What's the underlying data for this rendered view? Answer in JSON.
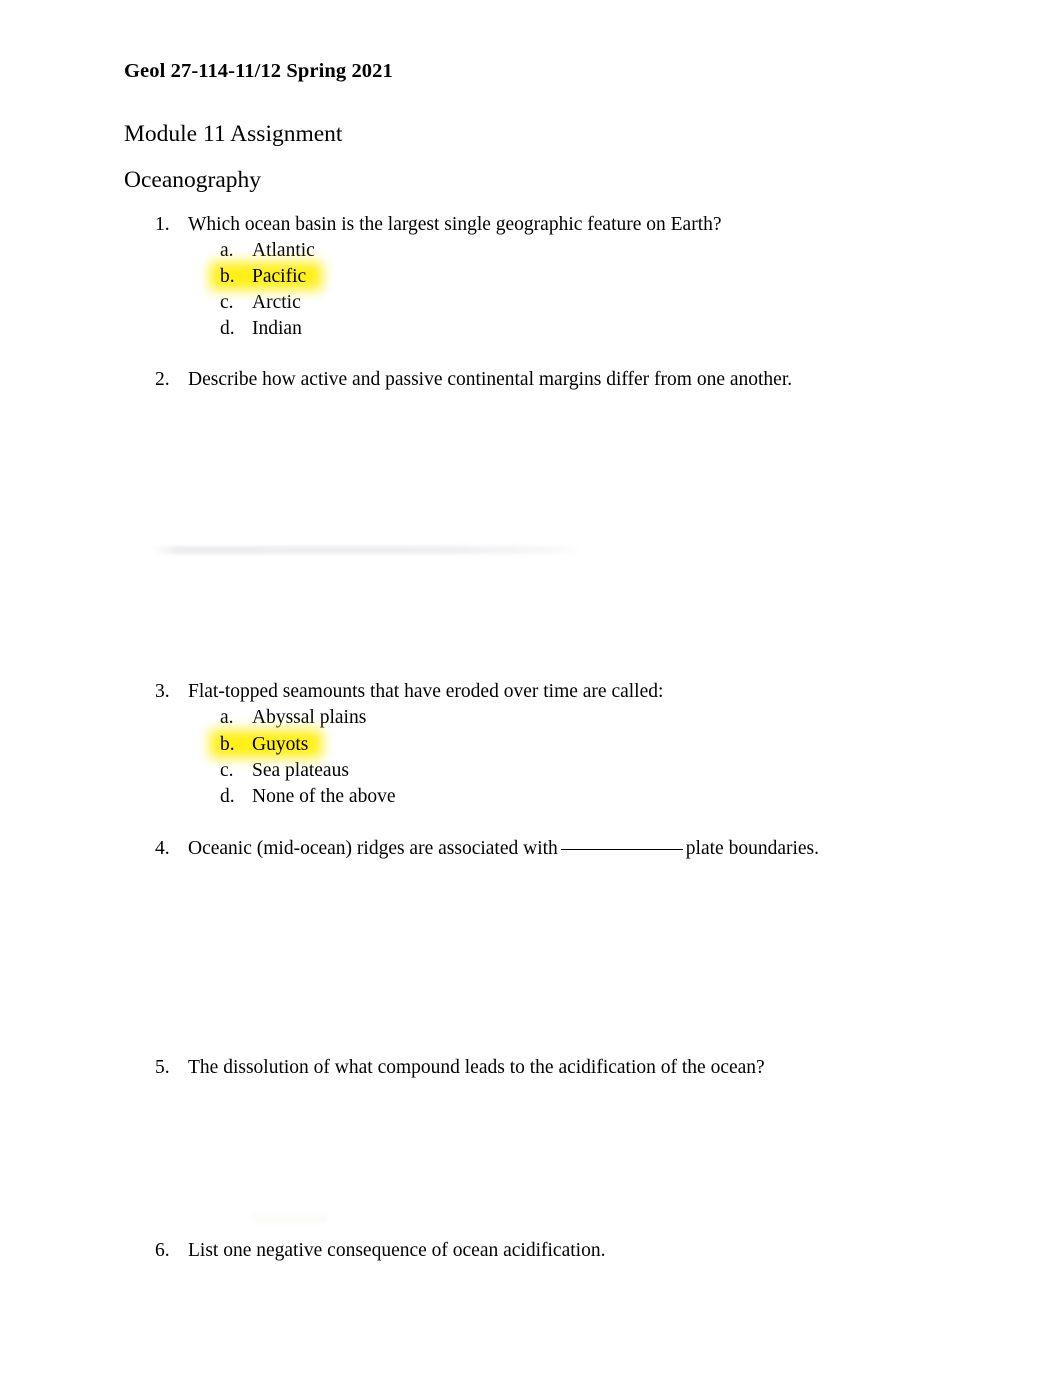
{
  "document": {
    "title": "Geol 27-114-11/12 Spring 2021",
    "heading_1": "Module 11 Assignment",
    "heading_2": "Oceanography"
  },
  "highlight_color": "#ffee00",
  "questions": [
    {
      "number": "1.",
      "text": "Which ocean basin is the largest single geographic feature on Earth?",
      "options": [
        {
          "letter": "a.",
          "text": "Atlantic",
          "highlighted": false
        },
        {
          "letter": "b.",
          "text": "Pacific",
          "highlighted": true
        },
        {
          "letter": "c.",
          "text": "Arctic",
          "highlighted": false
        },
        {
          "letter": "d.",
          "text": "Indian",
          "highlighted": false
        }
      ]
    },
    {
      "number": "2.",
      "text": "Describe how active and passive continental margins differ from one another.",
      "options": []
    },
    {
      "number": "3.",
      "text": "Flat-topped seamounts that have eroded over time are called:",
      "options": [
        {
          "letter": "a.",
          "text": "Abyssal plains",
          "highlighted": false
        },
        {
          "letter": "b.",
          "text": "Guyots",
          "highlighted": true
        },
        {
          "letter": "c.",
          "text": "Sea plateaus",
          "highlighted": false
        },
        {
          "letter": "d.",
          "text": "None of the above",
          "highlighted": false
        }
      ]
    },
    {
      "number": "4.",
      "text_before_blank": "Oceanic (mid-ocean) ridges are associated with",
      "text_after_blank": "plate boundaries.",
      "options": []
    },
    {
      "number": "5.",
      "text": "The dissolution of what compound leads to the acidification of the ocean?",
      "options": []
    },
    {
      "number": "6.",
      "text": "List one negative consequence of ocean acidification.",
      "options": []
    }
  ]
}
